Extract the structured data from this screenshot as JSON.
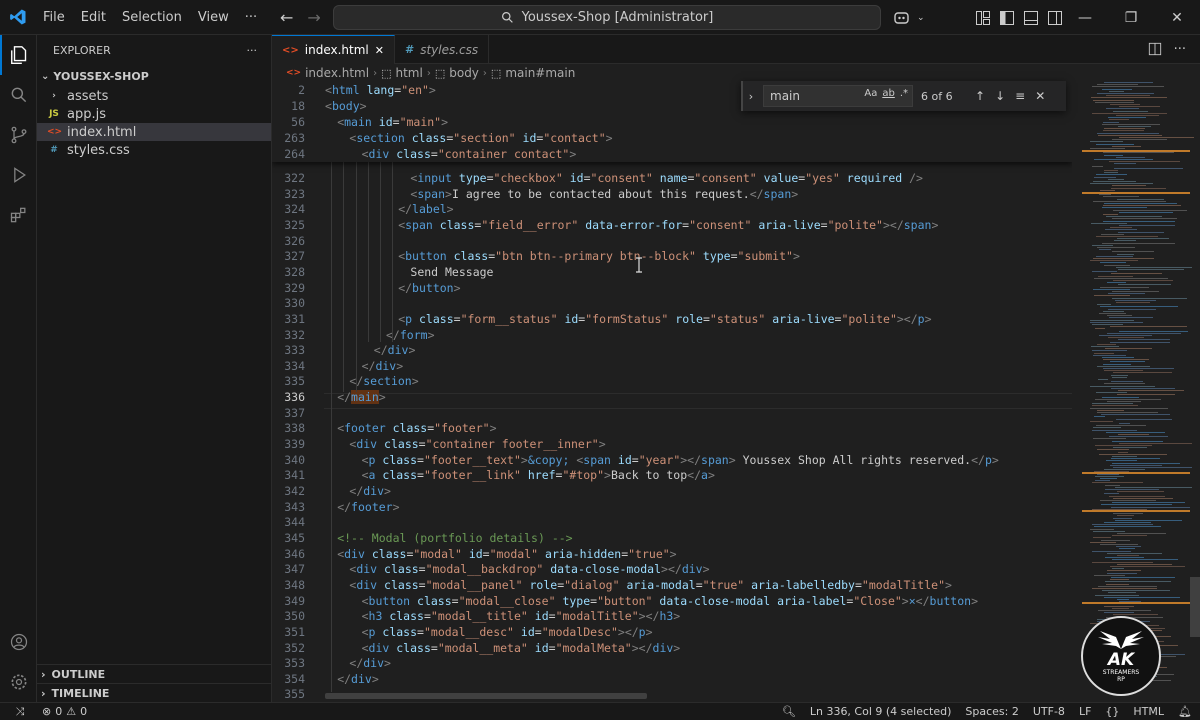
{
  "menu": [
    "File",
    "Edit",
    "Selection",
    "View"
  ],
  "command_center": "Youssex-Shop [Administrator]",
  "explorer": {
    "title": "EXPLORER",
    "folder": "YOUSSEX-SHOP",
    "items": [
      {
        "label": "assets",
        "icon": "chevron-right-icon",
        "type": "folder"
      },
      {
        "label": "app.js",
        "icon": "JS",
        "type": "js"
      },
      {
        "label": "index.html",
        "icon": "<>",
        "type": "html"
      },
      {
        "label": "styles.css",
        "icon": "#",
        "type": "css"
      }
    ],
    "outline": "OUTLINE",
    "timeline": "TIMELINE"
  },
  "tabs": [
    {
      "label": "index.html",
      "active": true
    },
    {
      "label": "styles.css",
      "active": false
    }
  ],
  "breadcrumb": [
    "index.html",
    "html",
    "body",
    "main#main"
  ],
  "find": {
    "query": "main",
    "count": "6 of 6",
    "opt_case": "Aa",
    "opt_word": "ab",
    "opt_regex": ".*"
  },
  "sticky_lines": [
    {
      "n": "2",
      "indent": 0,
      "html": "<span class='p'>&lt;</span><span class='t'>html</span> <span class='a'>lang</span>=<span class='s'>\"en\"</span><span class='p'>&gt;</span>"
    },
    {
      "n": "18",
      "indent": 0,
      "html": "<span class='p'>&lt;</span><span class='t'>body</span><span class='p'>&gt;</span>"
    },
    {
      "n": "56",
      "indent": 1,
      "html": "<span class='p'>&lt;</span><span class='t'>main</span> <span class='a'>id</span>=<span class='s'>\"main\"</span><span class='p'>&gt;</span>"
    },
    {
      "n": "263",
      "indent": 2,
      "html": "<span class='p'>&lt;</span><span class='t'>section</span> <span class='a'>class</span>=<span class='s'>\"section\"</span> <span class='a'>id</span>=<span class='s'>\"contact\"</span><span class='p'>&gt;</span>"
    },
    {
      "n": "264",
      "indent": 3,
      "html": "<span class='p'>&lt;</span><span class='t'>div</span> <span class='a'>class</span>=<span class='s'>\"container contact\"</span><span class='p'>&gt;</span>"
    }
  ],
  "code_lines": [
    {
      "n": "322",
      "indent": 7,
      "html": "<span class='p'>&lt;</span><span class='t'>input</span> <span class='a'>type</span>=<span class='s'>\"checkbox\"</span> <span class='a'>id</span>=<span class='s'>\"consent\"</span> <span class='a'>name</span>=<span class='s'>\"consent\"</span> <span class='a'>value</span>=<span class='s'>\"yes\"</span> <span class='a'>required</span> <span class='p'>/&gt;</span>"
    },
    {
      "n": "323",
      "indent": 7,
      "html": "<span class='p'>&lt;</span><span class='t'>span</span><span class='p'>&gt;</span>I agree to be contacted about this request.<span class='p'>&lt;/</span><span class='t'>span</span><span class='p'>&gt;</span>"
    },
    {
      "n": "324",
      "indent": 6,
      "html": "<span class='p'>&lt;/</span><span class='t'>label</span><span class='p'>&gt;</span>"
    },
    {
      "n": "325",
      "indent": 6,
      "html": "<span class='p'>&lt;</span><span class='t'>span</span> <span class='a'>class</span>=<span class='s'>\"field__error\"</span> <span class='a'>data-error-for</span>=<span class='s'>\"consent\"</span> <span class='a'>aria-live</span>=<span class='s'>\"polite\"</span><span class='p'>&gt;&lt;/</span><span class='t'>span</span><span class='p'>&gt;</span>"
    },
    {
      "n": "326",
      "indent": 0,
      "html": ""
    },
    {
      "n": "327",
      "indent": 6,
      "html": "<span class='p'>&lt;</span><span class='t'>button</span> <span class='a'>class</span>=<span class='s'>\"btn btn--primary btn--block\"</span> <span class='a'>type</span>=<span class='s'>\"submit\"</span><span class='p'>&gt;</span>"
    },
    {
      "n": "328",
      "indent": 7,
      "html": "Send Message"
    },
    {
      "n": "329",
      "indent": 6,
      "html": "<span class='p'>&lt;/</span><span class='t'>button</span><span class='p'>&gt;</span>"
    },
    {
      "n": "330",
      "indent": 0,
      "html": ""
    },
    {
      "n": "331",
      "indent": 6,
      "html": "<span class='p'>&lt;</span><span class='t'>p</span> <span class='a'>class</span>=<span class='s'>\"form__status\"</span> <span class='a'>id</span>=<span class='s'>\"formStatus\"</span> <span class='a'>role</span>=<span class='s'>\"status\"</span> <span class='a'>aria-live</span>=<span class='s'>\"polite\"</span><span class='p'>&gt;&lt;/</span><span class='t'>p</span><span class='p'>&gt;</span>"
    },
    {
      "n": "332",
      "indent": 5,
      "html": "<span class='p'>&lt;/</span><span class='t'>form</span><span class='p'>&gt;</span>"
    },
    {
      "n": "333",
      "indent": 4,
      "html": "<span class='p'>&lt;/</span><span class='t'>div</span><span class='p'>&gt;</span>"
    },
    {
      "n": "334",
      "indent": 3,
      "html": "<span class='p'>&lt;/</span><span class='t'>div</span><span class='p'>&gt;</span>"
    },
    {
      "n": "335",
      "indent": 2,
      "html": "<span class='p'>&lt;/</span><span class='t'>section</span><span class='p'>&gt;</span>"
    },
    {
      "n": "336",
      "indent": 1,
      "current": true,
      "html": "<span class='p'>&lt;/</span><span class='t hl'>main</span><span class='p'>&gt;</span>"
    },
    {
      "n": "337",
      "indent": 0,
      "html": ""
    },
    {
      "n": "338",
      "indent": 1,
      "html": "<span class='p'>&lt;</span><span class='t'>footer</span> <span class='a'>class</span>=<span class='s'>\"footer\"</span><span class='p'>&gt;</span>"
    },
    {
      "n": "339",
      "indent": 2,
      "html": "<span class='p'>&lt;</span><span class='t'>div</span> <span class='a'>class</span>=<span class='s'>\"container footer__inner\"</span><span class='p'>&gt;</span>"
    },
    {
      "n": "340",
      "indent": 3,
      "html": "<span class='p'>&lt;</span><span class='t'>p</span> <span class='a'>class</span>=<span class='s'>\"footer__text\"</span><span class='p'>&gt;</span><span class='e'>&amp;copy;</span> <span class='p'>&lt;</span><span class='t'>span</span> <span class='a'>id</span>=<span class='s'>\"year\"</span><span class='p'>&gt;&lt;/</span><span class='t'>span</span><span class='p'>&gt;</span> Youssex Shop All rights reserved.<span class='p'>&lt;/</span><span class='t'>p</span><span class='p'>&gt;</span>"
    },
    {
      "n": "341",
      "indent": 3,
      "html": "<span class='p'>&lt;</span><span class='t'>a</span> <span class='a'>class</span>=<span class='s'>\"footer__link\"</span> <span class='a'>href</span>=<span class='s'>\"#top\"</span><span class='p'>&gt;</span>Back to top<span class='p'>&lt;/</span><span class='t'>a</span><span class='p'>&gt;</span>"
    },
    {
      "n": "342",
      "indent": 2,
      "html": "<span class='p'>&lt;/</span><span class='t'>div</span><span class='p'>&gt;</span>"
    },
    {
      "n": "343",
      "indent": 1,
      "html": "<span class='p'>&lt;/</span><span class='t'>footer</span><span class='p'>&gt;</span>"
    },
    {
      "n": "344",
      "indent": 0,
      "html": ""
    },
    {
      "n": "345",
      "indent": 1,
      "html": "<span class='c'>&lt;!-- Modal (portfolio details) --&gt;</span>"
    },
    {
      "n": "346",
      "indent": 1,
      "html": "<span class='p'>&lt;</span><span class='t'>div</span> <span class='a'>class</span>=<span class='s'>\"modal\"</span> <span class='a'>id</span>=<span class='s'>\"modal\"</span> <span class='a'>aria-hidden</span>=<span class='s'>\"true\"</span><span class='p'>&gt;</span>"
    },
    {
      "n": "347",
      "indent": 2,
      "html": "<span class='p'>&lt;</span><span class='t'>div</span> <span class='a'>class</span>=<span class='s'>\"modal__backdrop\"</span> <span class='a'>data-close-modal</span><span class='p'>&gt;&lt;/</span><span class='t'>div</span><span class='p'>&gt;</span>"
    },
    {
      "n": "348",
      "indent": 2,
      "html": "<span class='p'>&lt;</span><span class='t'>div</span> <span class='a'>class</span>=<span class='s'>\"modal__panel\"</span> <span class='a'>role</span>=<span class='s'>\"dialog\"</span> <span class='a'>aria-modal</span>=<span class='s'>\"true\"</span> <span class='a'>aria-labelledby</span>=<span class='s'>\"modalTitle\"</span><span class='p'>&gt;</span>"
    },
    {
      "n": "349",
      "indent": 3,
      "html": "<span class='p'>&lt;</span><span class='t'>button</span> <span class='a'>class</span>=<span class='s'>\"modal__close\"</span> <span class='a'>type</span>=<span class='s'>\"button\"</span> <span class='a'>data-close-modal</span> <span class='a'>aria-label</span>=<span class='s'>\"Close\"</span><span class='p'>&gt;</span><span class='e'>×</span><span class='p'>&lt;/</span><span class='t'>button</span><span class='p'>&gt;</span>"
    },
    {
      "n": "350",
      "indent": 3,
      "html": "<span class='p'>&lt;</span><span class='t'>h3</span> <span class='a'>class</span>=<span class='s'>\"modal__title\"</span> <span class='a'>id</span>=<span class='s'>\"modalTitle\"</span><span class='p'>&gt;&lt;/</span><span class='t'>h3</span><span class='p'>&gt;</span>"
    },
    {
      "n": "351",
      "indent": 3,
      "html": "<span class='p'>&lt;</span><span class='t'>p</span> <span class='a'>class</span>=<span class='s'>\"modal__desc\"</span> <span class='a'>id</span>=<span class='s'>\"modalDesc\"</span><span class='p'>&gt;&lt;/</span><span class='t'>p</span><span class='p'>&gt;</span>"
    },
    {
      "n": "352",
      "indent": 3,
      "html": "<span class='p'>&lt;</span><span class='t'>div</span> <span class='a'>class</span>=<span class='s'>\"modal__meta\"</span> <span class='a'>id</span>=<span class='s'>\"modalMeta\"</span><span class='p'>&gt;&lt;/</span><span class='t'>div</span><span class='p'>&gt;</span>"
    },
    {
      "n": "353",
      "indent": 2,
      "html": "<span class='p'>&lt;/</span><span class='t'>div</span><span class='p'>&gt;</span>"
    },
    {
      "n": "354",
      "indent": 1,
      "html": "<span class='p'>&lt;/</span><span class='t'>div</span><span class='p'>&gt;</span>"
    },
    {
      "n": "355",
      "indent": 0,
      "html": ""
    }
  ],
  "status": {
    "errors": "0",
    "warnings": "0",
    "position": "Ln 336, Col 9 (4 selected)",
    "spaces": "Spaces: 2",
    "encoding": "UTF-8",
    "eol": "LF",
    "language": "HTML"
  },
  "watermark": {
    "big": "AK",
    "small1": "STREAMERS",
    "small2": "RP"
  },
  "colors": {
    "accent": "#0078d4",
    "tag": "#569cd6",
    "attr": "#9cdcfe",
    "string": "#ce9178",
    "comment": "#6a9955"
  }
}
